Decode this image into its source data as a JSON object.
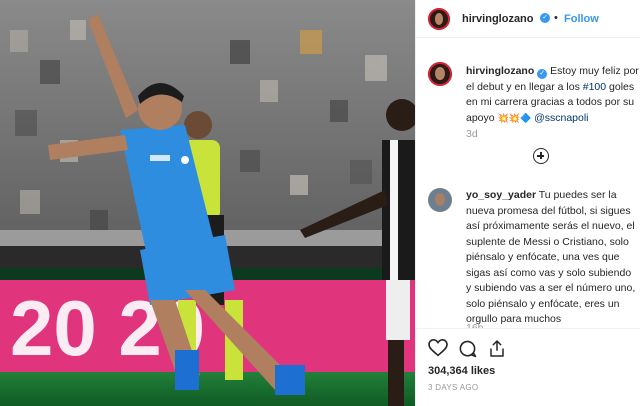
{
  "post": {
    "username": "hirvinglozano",
    "follow_label": "Follow",
    "separator": "•",
    "caption": {
      "username": "hirvinglozano",
      "text_before": "Estoy muy feliz por el debut y en llegar a los",
      "hashtag": "#100",
      "text_after": "goles en mi carrera gracias a todos por su apoyo",
      "emojis": "💥💥🔷",
      "mention": "@sscnapoli",
      "time": "3d"
    },
    "comment": {
      "username": "yo_soy_yader",
      "text": "Tu puedes ser la nueva promesa del fútbol, si sigues así próximamente serás el nuevo, el suplente de Messi o Cristiano, solo piénsalo y enfócate, una ves que sigas así como vas y solo subiendo y subiendo vas a ser el número uno, solo piénsalo y enfócate, eres un orgullo para muchos",
      "time": "16h"
    },
    "likes": "304,364 likes",
    "date": "3 DAYS AGO"
  },
  "photo": {
    "board_text": "20 20"
  },
  "colors": {
    "accent": "#3897f0",
    "link": "#003569",
    "napoli_blue": "#2f8de0",
    "board_pink": "#e0357d"
  },
  "icons": [
    "verified-icon",
    "plus-circle-icon",
    "heart-icon",
    "comment-icon",
    "share-icon"
  ]
}
